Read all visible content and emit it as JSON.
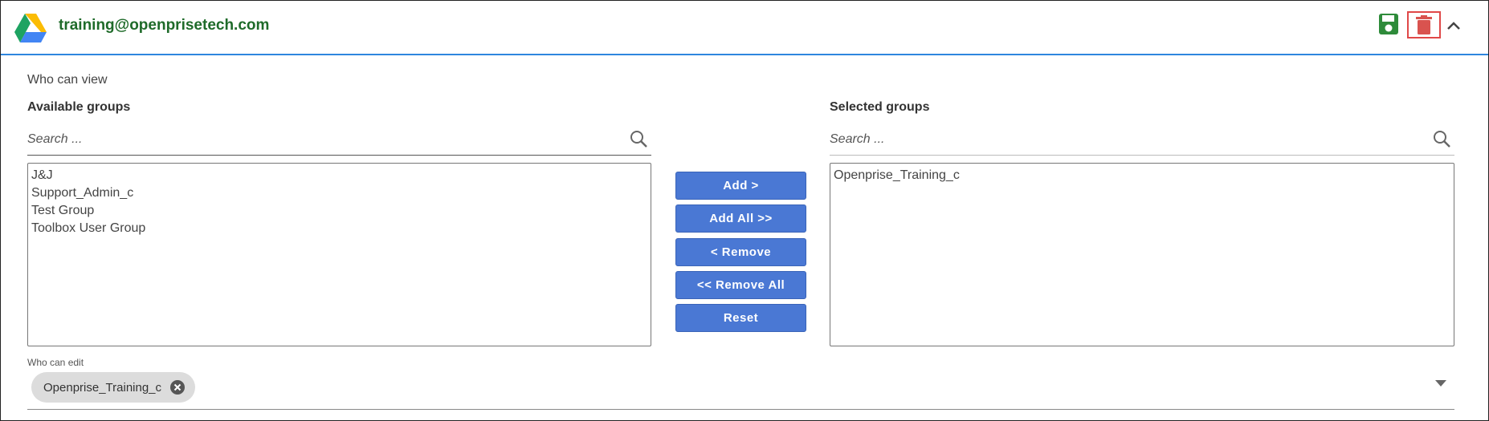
{
  "header": {
    "account": "training@openprisetech.com",
    "icons": {
      "logo": "google-drive-icon",
      "save": "save-icon",
      "delete": "trash-icon",
      "collapse": "chevron-up-icon"
    },
    "colors": {
      "account_text": "#1f6b2a",
      "save": "#2e8b3a",
      "delete": "#d9534f",
      "divider": "#2e86de"
    }
  },
  "view": {
    "section_label": "Who can view",
    "available": {
      "title": "Available groups",
      "search_placeholder": "Search ...",
      "items": [
        "J&J",
        "Support_Admin_c",
        "Test Group",
        "Toolbox User Group"
      ]
    },
    "selected": {
      "title": "Selected groups",
      "search_placeholder": "Search ...",
      "items": [
        "Openprise_Training_c"
      ]
    },
    "buttons": {
      "add": "Add >",
      "add_all": "Add All >>",
      "remove": "< Remove",
      "remove_all": "<< Remove All",
      "reset": "Reset"
    },
    "button_color": "#4a78d4"
  },
  "edit": {
    "label": "Who can edit",
    "chips": [
      "Openprise_Training_c"
    ]
  }
}
